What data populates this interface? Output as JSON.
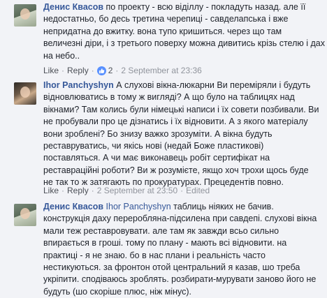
{
  "comments": [
    {
      "author": "Денис Квасов",
      "mention": "",
      "lines": [
        "по проекту - всю віділлу - покладуть назад. але її",
        "недостатньо, бо десь третина черепиці - савделапська і вже",
        "непридатна до вжитку. вона тупо кришиться. через що там",
        "величезні діри, і з третього поверху можна дивитись крізь стелю і дах",
        "на небо.."
      ],
      "actions": {
        "like": "Like",
        "reply": "Reply",
        "reactions": "2",
        "time": "2 September at 23:36",
        "edited": ""
      }
    },
    {
      "author": "Ihor Panchyshyn",
      "mention": "",
      "lines": [
        "А слухові вікна-люкарни Ви переміряли і будуть",
        "відновлюватись в тому ж вигляді? А що було на таблицях над",
        "вікнами? Там колись були німецькі написи і їх совети позбивали. Ви",
        "не пробували про це дізнатись і їх відновити. А з якого матеріалу",
        "вони зроблені? Бо знизу важко зрозуміти. А вікна будуть",
        "реставруватись, чи якісь нові (недай Боже пластикові)",
        "поставляться. А чи має виконавець робіт сертифікат на",
        "реставраційні роботи? Ви ж розумієте, якщо хоч трохи щось буде",
        "не так то ж затягають по прокуратурах. Прецедентів повно."
      ],
      "actions": {
        "like": "Like",
        "reply": "Reply",
        "reactions": "",
        "time": "2 September at 23:50",
        "edited": "Edited"
      }
    },
    {
      "author": "Денис Квасов",
      "mention": "Ihor Panchyshyn",
      "lines": [
        "таблиць ніяких не бачив.",
        "конструкція даху переробляна-підсилена при савдепі. слухові вікна",
        "мали теж реставровувати. але там як завжди всьо сильно",
        "впирається в гроші. тому по плану - мають всі відновити. на",
        "практиці - я не знаю. бо в нас плани і реальність часто",
        "нестикуються. за фронтон отой центральний я казав, шо треба",
        "укріпити. сподіваюсь зроблять. розбирати-мурувати заново його не",
        "будуть (шо скоріше плюс, ніж мінус)."
      ],
      "actions": null
    }
  ],
  "colors": {
    "link": "#365899",
    "meta": "#90949c",
    "text": "#1d2129",
    "like_badge": "#5890ff"
  }
}
